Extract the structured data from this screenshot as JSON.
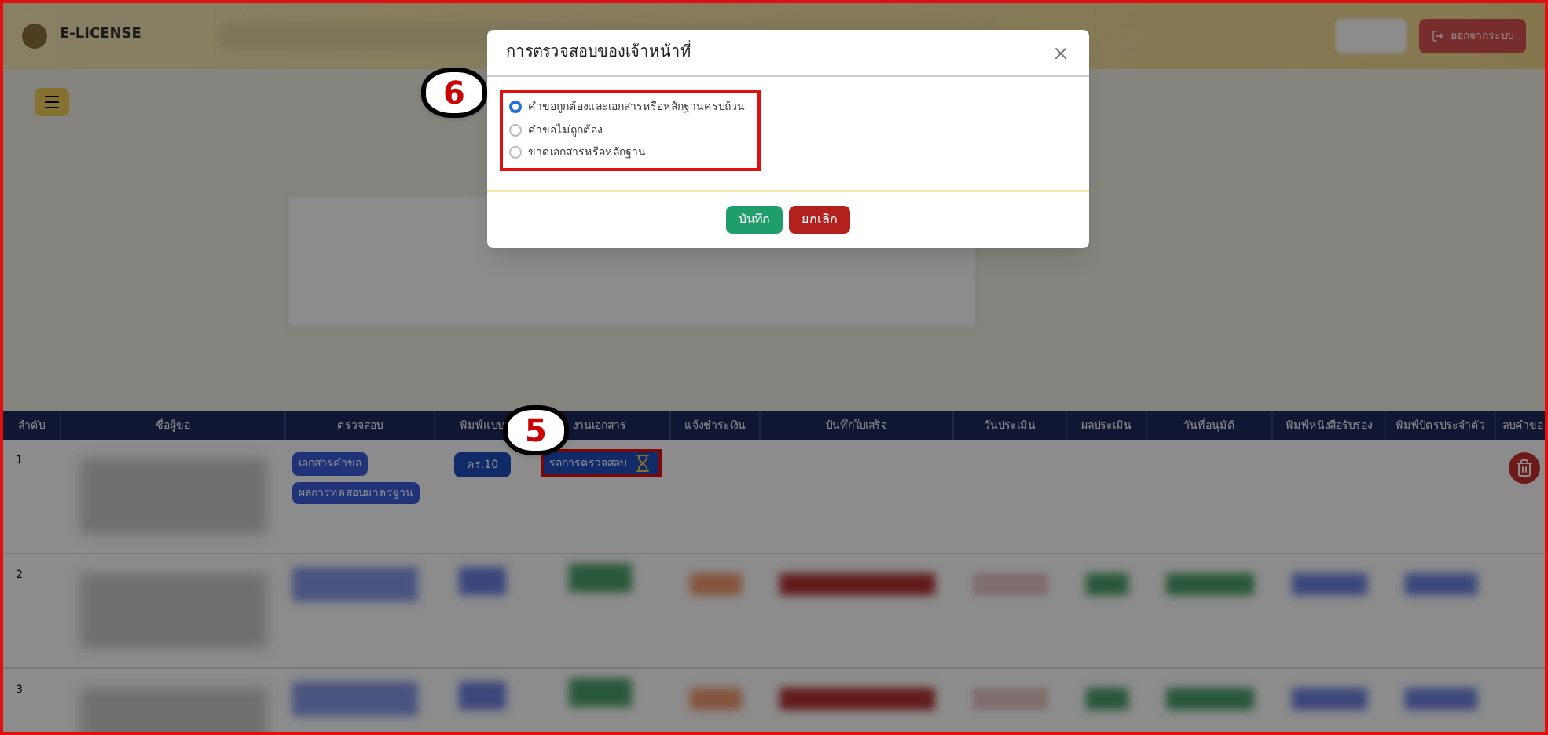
{
  "header": {
    "brand": "E-LICENSE",
    "logout_label": "ออกจากระบบ"
  },
  "table": {
    "columns": [
      "ลำดับ",
      "ชื่อผู้ขอ",
      "ตรวจสอบ",
      "พิมพ์แบบ",
      "งานเอกสาร",
      "แจ้งชำระเงิน",
      "บันทึกใบเสร็จ",
      "วันประเมิน",
      "ผลประเมิน",
      "วันที่อนุมัติ",
      "พิมพ์หนังสือรับรอง",
      "พิมพ์บัตรประจำตัว",
      "ลบคำขอ"
    ],
    "rows": [
      {
        "index": "1",
        "check_buttons": [
          "เอกสารคำขอ",
          "ผลการทดสอบมาตรฐาน"
        ],
        "form_button": "คร.10",
        "status": "รอการตรวจสอบ"
      },
      {
        "index": "2"
      },
      {
        "index": "3"
      }
    ]
  },
  "dialog": {
    "title": "การตรวจสอบของเจ้าหน้าที่",
    "options": [
      {
        "label": "คำขอถูกต้องและเอกสารหรือหลักฐานครบถ้วน",
        "selected": true
      },
      {
        "label": "คำขอไม่ถูกต้อง",
        "selected": false
      },
      {
        "label": "ขาดเอกสารหรือหลักฐาน",
        "selected": false
      }
    ],
    "buttons": [
      {
        "label": "บันทึก",
        "kind": "save"
      },
      {
        "label": "ยกเลิก",
        "kind": "cancel"
      }
    ]
  },
  "annotations": [
    {
      "label": "6"
    },
    {
      "label": "5"
    }
  ]
}
